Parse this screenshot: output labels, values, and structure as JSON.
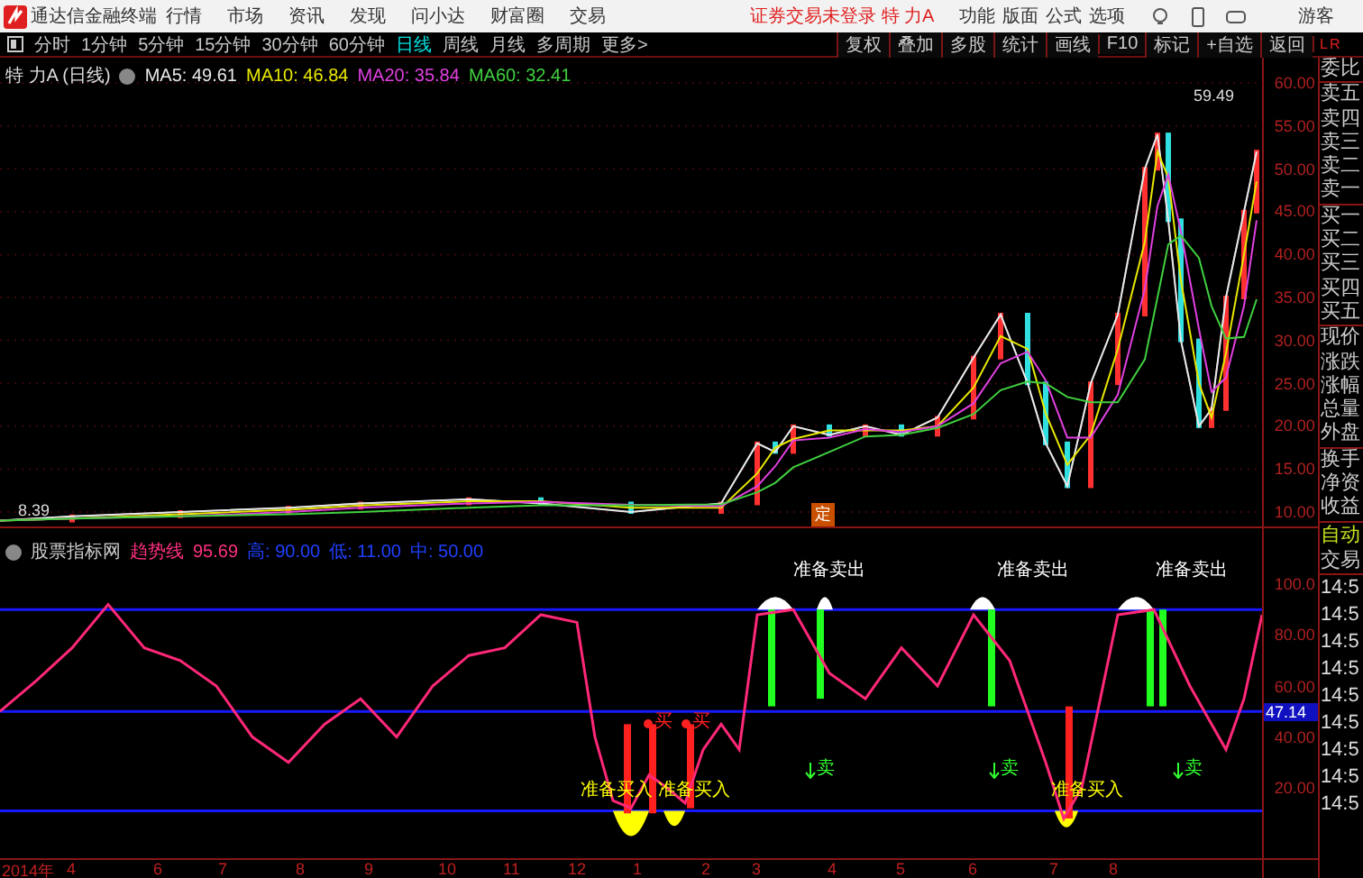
{
  "app_bar": {
    "title": "通达信金融终端",
    "menus": [
      "行情",
      "市场",
      "资讯",
      "发现",
      "问小达",
      "财富圈",
      "交易"
    ],
    "notice": "证券交易未登录 特 力A",
    "actions": [
      "功能",
      "版面",
      "公式",
      "选项"
    ],
    "user": "游客"
  },
  "period_bar": {
    "periods": [
      {
        "label": "分时",
        "selected": false
      },
      {
        "label": "1分钟",
        "selected": false
      },
      {
        "label": "5分钟",
        "selected": false
      },
      {
        "label": "15分钟",
        "selected": false
      },
      {
        "label": "30分钟",
        "selected": false
      },
      {
        "label": "60分钟",
        "selected": false
      },
      {
        "label": "日线",
        "selected": true
      },
      {
        "label": "周线",
        "selected": false
      },
      {
        "label": "月线",
        "selected": false
      },
      {
        "label": "多周期",
        "selected": false
      },
      {
        "label": "更多>",
        "selected": false
      }
    ],
    "tools": [
      "复权",
      "叠加",
      "多股",
      "统计",
      "画线",
      "F10",
      "标记",
      "+自选",
      "返回"
    ],
    "corner": [
      "L",
      "R"
    ]
  },
  "price_chart": {
    "title": "特 力A (日线)",
    "ma": [
      {
        "label": "MA5: 49.61",
        "color": "#e8e8e8"
      },
      {
        "label": "MA10: 46.84",
        "color": "#e8e800"
      },
      {
        "label": "MA20: 35.84",
        "color": "#e040e0"
      },
      {
        "label": "MA60: 32.41",
        "color": "#40d040"
      }
    ],
    "high_label": "59.49",
    "low_label": "8.39",
    "marker": "定",
    "axis": [
      "60.00",
      "55.00",
      "50.00",
      "45.00",
      "40.00",
      "35.00",
      "30.00",
      "25.00",
      "20.00",
      "15.00",
      "10.00"
    ]
  },
  "indicator": {
    "title": "股票指标网",
    "line_label": "趋势线",
    "value": "95.69",
    "levels": [
      "高: 90.00",
      "低: 11.00",
      "中: 50.00"
    ],
    "signals": [
      {
        "kind": "buy-dot",
        "text": "买"
      },
      {
        "kind": "buy-dot",
        "text": "买"
      },
      {
        "kind": "buy-ready",
        "text": "准备买入"
      },
      {
        "kind": "buy-ready",
        "text": "准备买入"
      },
      {
        "kind": "sell-ready",
        "text": "准备卖出"
      },
      {
        "kind": "sell",
        "text": "卖"
      },
      {
        "kind": "sell-ready",
        "text": "准备卖出"
      },
      {
        "kind": "sell",
        "text": "卖"
      },
      {
        "kind": "buy-ready",
        "text": "准备买入"
      },
      {
        "kind": "sell-ready",
        "text": "准备卖出"
      },
      {
        "kind": "sell",
        "text": "卖"
      }
    ],
    "axis": [
      "100.0",
      "80.00",
      "60.00",
      "40.00",
      "20.00"
    ],
    "cursor_value": "47.14"
  },
  "time_axis": [
    "2014年",
    "4",
    "6",
    "7",
    "8",
    "9",
    "10",
    "11",
    "12",
    "1",
    "2",
    "3",
    "4",
    "5",
    "6",
    "7",
    "8"
  ],
  "quote_panel": {
    "groups": [
      [
        "委比"
      ],
      [
        "卖五",
        "卖四",
        "卖三",
        "卖二",
        "卖一"
      ],
      [
        "买一",
        "买二",
        "买三",
        "买四",
        "买五"
      ],
      [
        "现价",
        "涨跌",
        "涨幅",
        "总量",
        "外盘"
      ],
      [
        "换手",
        "净资",
        "收益"
      ]
    ],
    "auto": [
      "自动",
      "交易"
    ],
    "times": [
      "14:5",
      "14:5",
      "14:5",
      "14:5",
      "14:5",
      "14:5",
      "14:5",
      "14:5",
      "14:5"
    ]
  }
}
